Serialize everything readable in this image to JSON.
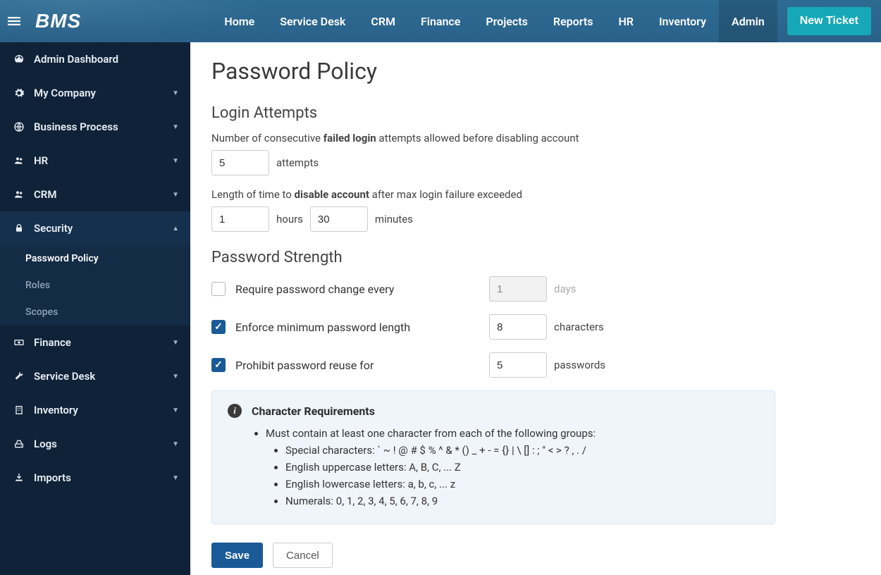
{
  "header": {
    "brand": "BMS",
    "nav": [
      "Home",
      "Service Desk",
      "CRM",
      "Finance",
      "Projects",
      "Reports",
      "HR",
      "Inventory",
      "Admin"
    ],
    "active_nav": "Admin",
    "new_ticket_label": "New Ticket"
  },
  "sidebar": {
    "items": [
      {
        "label": "Admin Dashboard",
        "icon": "dashboard",
        "expandable": false
      },
      {
        "label": "My Company",
        "icon": "gear",
        "expandable": true
      },
      {
        "label": "Business Process",
        "icon": "globe",
        "expandable": true
      },
      {
        "label": "HR",
        "icon": "users",
        "expandable": true
      },
      {
        "label": "CRM",
        "icon": "users",
        "expandable": true
      },
      {
        "label": "Security",
        "icon": "lock",
        "expandable": true,
        "expanded": true,
        "children": [
          {
            "label": "Password Policy",
            "active": true
          },
          {
            "label": "Roles",
            "active": false
          },
          {
            "label": "Scopes",
            "active": false
          }
        ]
      },
      {
        "label": "Finance",
        "icon": "money",
        "expandable": true
      },
      {
        "label": "Service Desk",
        "icon": "wrench",
        "expandable": true
      },
      {
        "label": "Inventory",
        "icon": "building",
        "expandable": true
      },
      {
        "label": "Logs",
        "icon": "drive",
        "expandable": true
      },
      {
        "label": "Imports",
        "icon": "download",
        "expandable": true
      }
    ]
  },
  "page": {
    "title": "Password Policy",
    "login_attempts": {
      "section_title": "Login Attempts",
      "failed_label_pre": "Number of consecutive ",
      "failed_label_bold": "failed login",
      "failed_label_post": " attempts allowed before disabling account",
      "attempts_value": "5",
      "attempts_unit": "attempts",
      "disable_label_pre": "Length of time to ",
      "disable_label_bold": "disable account",
      "disable_label_post": " after max login failure exceeded",
      "hours_value": "1",
      "hours_unit": "hours",
      "minutes_value": "30",
      "minutes_unit": "minutes"
    },
    "strength": {
      "section_title": "Password Strength",
      "require_change": {
        "checked": false,
        "label": "Require password change every",
        "value": "1",
        "unit": "days"
      },
      "min_length": {
        "checked": true,
        "label": "Enforce minimum password length",
        "value": "8",
        "unit": "characters"
      },
      "prohibit_reuse": {
        "checked": true,
        "label": "Prohibit password reuse for",
        "value": "5",
        "unit": "passwords"
      }
    },
    "char_req": {
      "title": "Character Requirements",
      "intro": "Must contain at least one character from each of the following groups:",
      "items": [
        "Special characters: ` ~ ! @ # $ % ^ & * () _ + - = {} | \\ [] : ; \" < > ? , . /",
        "English uppercase letters: A, B, C, ... Z",
        "English lowercase letters: a, b, c, ... z",
        "Numerals: 0, 1, 2, 3, 4, 5, 6, 7, 8, 9"
      ]
    },
    "buttons": {
      "save": "Save",
      "cancel": "Cancel"
    }
  }
}
